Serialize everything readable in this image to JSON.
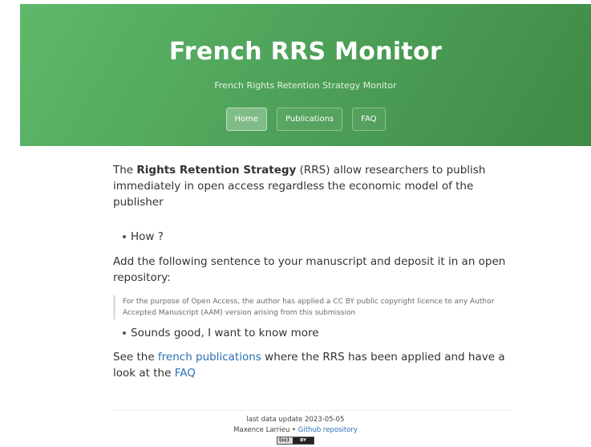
{
  "header": {
    "title": "French RRS Monitor",
    "subtitle": "French Rights Retention Strategy Monitor",
    "nav": [
      {
        "label": "Home",
        "active": true
      },
      {
        "label": "Publications",
        "active": false
      },
      {
        "label": "FAQ",
        "active": false
      }
    ]
  },
  "main": {
    "intro_prefix": "The ",
    "intro_strong": "Rights Retention Strategy",
    "intro_suffix": " (RRS) allow researchers to publish immediately in open access regardless the economic model of the publisher",
    "item_how": "How ?",
    "add_sentence": "Add the following sentence to your manuscript and deposit it in an open repository:",
    "quote": "For the purpose of Open Access, the author has applied a CC BY public copyright licence to any Author Accepted Manuscript (AAM) version arising from this submission",
    "item_sounds": "Sounds good, I want to know more",
    "see_prefix": "See the ",
    "see_link": "french publications",
    "see_middle": " where the RRS has been applied and have a look at the ",
    "faq_link": "FAQ"
  },
  "footer": {
    "last_update": "last data update 2023-05-05",
    "author": "Maxence Larrieu",
    "separator": " • ",
    "repo_link": "Github repository",
    "license_cc": "(cc)",
    "license_by": "BY"
  },
  "colors": {
    "header_green": "#4fa35a",
    "link_blue": "#2a6fb8"
  }
}
